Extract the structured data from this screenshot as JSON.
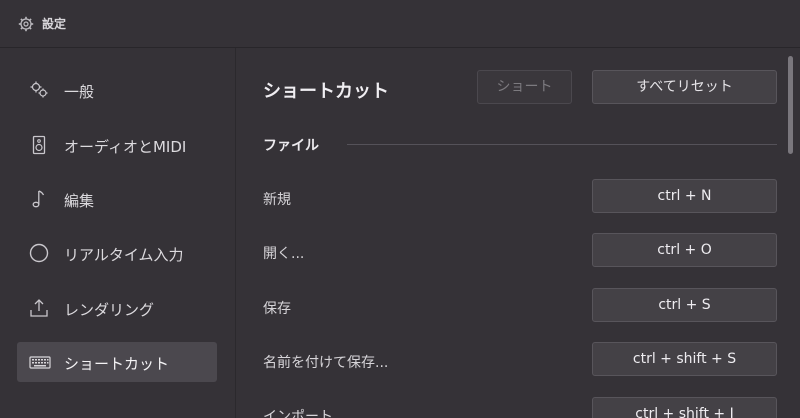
{
  "window": {
    "title": "設定",
    "icon": "gear-icon"
  },
  "sidebar": {
    "items": [
      {
        "label": "一般",
        "icon": "gears-icon",
        "active": false
      },
      {
        "label": "オーディオとMIDI",
        "icon": "speaker-icon",
        "active": false
      },
      {
        "label": "編集",
        "icon": "music-note-icon",
        "active": false
      },
      {
        "label": "リアルタイム入力",
        "icon": "circle-icon",
        "active": false
      },
      {
        "label": "レンダリング",
        "icon": "upload-tray-icon",
        "active": false
      },
      {
        "label": "ショートカット",
        "icon": "keyboard-icon",
        "active": true
      }
    ]
  },
  "main": {
    "title": "ショートカット",
    "short_button": "ショート",
    "reset_button": "すべてリセット",
    "section": "ファイル",
    "rows": [
      {
        "label": "新規",
        "shortcut": "ctrl + N"
      },
      {
        "label": "開く...",
        "shortcut": "ctrl + O"
      },
      {
        "label": "保存",
        "shortcut": "ctrl + S"
      },
      {
        "label": "名前を付けて保存...",
        "shortcut": "ctrl + shift + S"
      },
      {
        "label": "インポート",
        "shortcut": "ctrl + shift + I"
      }
    ]
  },
  "colors": {
    "background": "#353237",
    "active": "#4b484e",
    "button": "#444146"
  }
}
